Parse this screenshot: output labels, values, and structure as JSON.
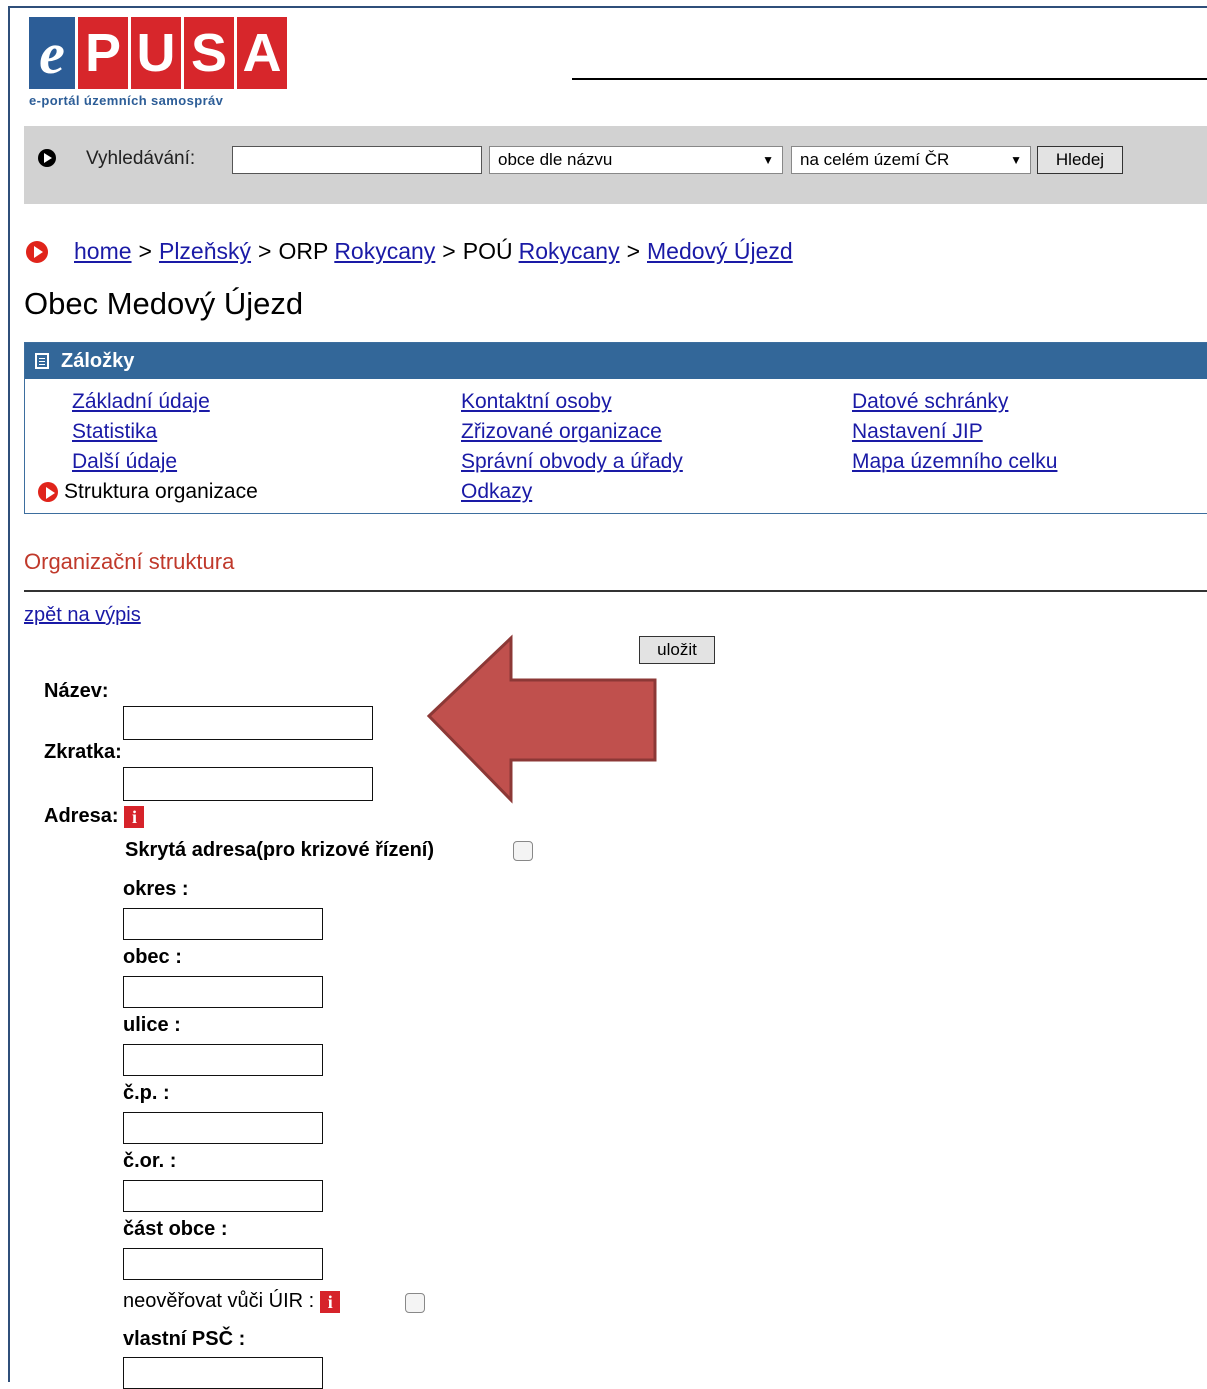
{
  "logo": {
    "letters": [
      "e",
      "P",
      "U",
      "S",
      "A"
    ],
    "subtitle": "e-portál územních samospráv"
  },
  "search": {
    "label": "Vyhledávání:",
    "query": "",
    "type_select": "obce dle názvu",
    "area_select": "na celém území ČR",
    "button": "Hledej"
  },
  "breadcrumb": {
    "home": "home",
    "sep": ">",
    "region": "Plzeňský",
    "orp_prefix": "ORP",
    "orp": "Rokycany",
    "pou_prefix": "POÚ",
    "pou": "Rokycany",
    "municipality": "Medový Újezd"
  },
  "page_title": "Obec Medový Újezd",
  "tabs": {
    "header": "Záložky",
    "col1": [
      "Základní údaje",
      "Statistika",
      "Další údaje"
    ],
    "active": "Struktura organizace",
    "col2": [
      "Kontaktní osoby",
      "Zřizované organizace",
      "Správní obvody a úřady",
      "Odkazy"
    ],
    "col3": [
      "Datové schránky",
      "Nastavení JIP",
      "Mapa územního celku"
    ]
  },
  "section_title": "Organizační struktura",
  "back_link": "zpět na výpis",
  "save_button": "uložit",
  "form": {
    "name_label": "Název:",
    "abbr_label": "Zkratka:",
    "address_label": "Adresa:",
    "hidden_address_label": "Skrytá adresa(pro krizové řízení)",
    "district_label": "okres :",
    "municipality_label": "obec :",
    "street_label": "ulice :",
    "cp_label": "č.p. :",
    "cor_label": "č.or. :",
    "part_label": "část obce :",
    "noverify_label": "neověřovat vůči ÚIR :",
    "zip_label": "vlastní PSČ :",
    "info_glyph": "i"
  },
  "colors": {
    "tabs_header": "#336799",
    "logo_red": "#d7262b",
    "logo_blue": "#2c5d97",
    "arrow": "#c0504d",
    "section": "#c0392b"
  }
}
